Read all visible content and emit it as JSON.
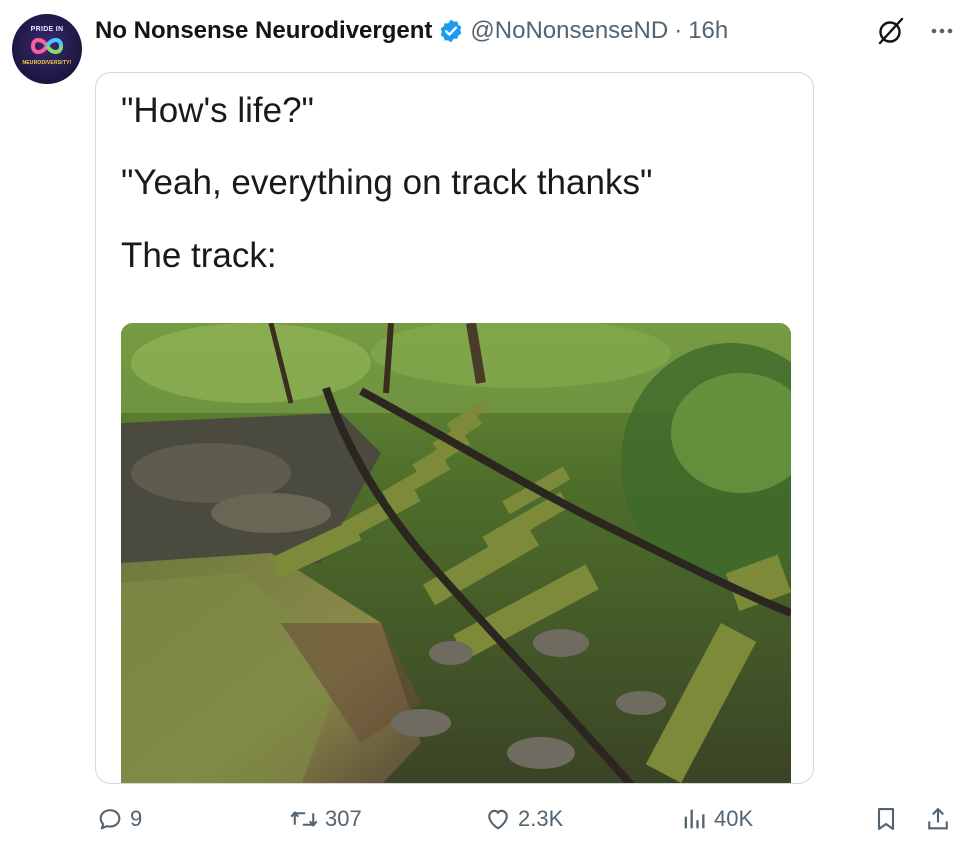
{
  "avatar": {
    "text_top": "PRIDE IN",
    "text_bottom": "NEURODIVERSITY!"
  },
  "author": {
    "display_name": "No Nonsense Neurodivergent",
    "handle": "@NoNonsenseND",
    "separator": "·",
    "time": "16h",
    "verified": true
  },
  "icons": {
    "verified": "verified-badge-icon",
    "grok": "grok-icon",
    "more": "more-icon",
    "reply": "reply-icon",
    "repost": "repost-icon",
    "like": "heart-icon",
    "views": "views-icon",
    "bookmark": "bookmark-icon",
    "share": "share-icon"
  },
  "post": {
    "line1": "\"How's life?\"",
    "line2": "\"Yeah, everything on track thanks\"",
    "line3": "The track:"
  },
  "stats": {
    "replies": "9",
    "reposts": "307",
    "likes": "2.3K",
    "views": "40K"
  },
  "colors": {
    "text": "#0f1419",
    "muted": "#536471",
    "verified": "#1d9bf0",
    "border": "#cfd9de"
  }
}
